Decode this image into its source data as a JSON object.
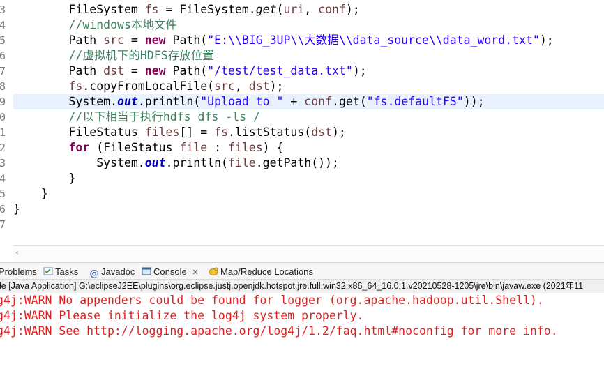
{
  "editor": {
    "line_numbers": [
      "3",
      "4",
      "5",
      "6",
      "7",
      "8",
      "9",
      "0",
      "1",
      "2",
      "3",
      "4",
      "5",
      "6",
      "7"
    ],
    "lines": [
      [
        {
          "t": "        FileSystem ",
          "c": ""
        },
        {
          "t": "fs",
          "c": "var"
        },
        {
          "t": " = FileSystem.",
          "c": ""
        },
        {
          "t": "get",
          "c": "mth"
        },
        {
          "t": "(",
          "c": ""
        },
        {
          "t": "uri",
          "c": "var"
        },
        {
          "t": ", ",
          "c": ""
        },
        {
          "t": "conf",
          "c": "var"
        },
        {
          "t": ");",
          "c": ""
        }
      ],
      [
        {
          "t": "        //windows本地文件",
          "c": "cm"
        }
      ],
      [
        {
          "t": "        Path ",
          "c": ""
        },
        {
          "t": "src",
          "c": "var"
        },
        {
          "t": " = ",
          "c": ""
        },
        {
          "t": "new",
          "c": "kw"
        },
        {
          "t": " Path(",
          "c": ""
        },
        {
          "t": "\"E:\\\\BIG_3UP\\\\大数据\\\\data_source\\\\data_word.txt\"",
          "c": "str"
        },
        {
          "t": ");",
          "c": ""
        }
      ],
      [
        {
          "t": "        //虚拟机下的HDFS存放位置",
          "c": "cm"
        }
      ],
      [
        {
          "t": "        Path ",
          "c": ""
        },
        {
          "t": "dst",
          "c": "var"
        },
        {
          "t": " = ",
          "c": ""
        },
        {
          "t": "new",
          "c": "kw"
        },
        {
          "t": " Path(",
          "c": ""
        },
        {
          "t": "\"/test/test_data.txt\"",
          "c": "str"
        },
        {
          "t": ");",
          "c": ""
        }
      ],
      [
        {
          "t": "        ",
          "c": ""
        },
        {
          "t": "fs",
          "c": "var"
        },
        {
          "t": ".copyFromLocalFile(",
          "c": ""
        },
        {
          "t": "src",
          "c": "var"
        },
        {
          "t": ", ",
          "c": ""
        },
        {
          "t": "dst",
          "c": "var"
        },
        {
          "t": ");",
          "c": ""
        }
      ],
      [
        {
          "t": "        System.",
          "c": ""
        },
        {
          "t": "out",
          "c": "fld"
        },
        {
          "t": ".println(",
          "c": ""
        },
        {
          "t": "\"Upload to \"",
          "c": "str"
        },
        {
          "t": " + ",
          "c": ""
        },
        {
          "t": "conf",
          "c": "var"
        },
        {
          "t": ".get(",
          "c": ""
        },
        {
          "t": "\"fs.defaultFS\"",
          "c": "str"
        },
        {
          "t": "));",
          "c": ""
        }
      ],
      [
        {
          "t": "        //以下相当于执行hdfs dfs -ls /",
          "c": "cm"
        }
      ],
      [
        {
          "t": "        FileStatus ",
          "c": ""
        },
        {
          "t": "files",
          "c": "var"
        },
        {
          "t": "[] = ",
          "c": ""
        },
        {
          "t": "fs",
          "c": "var"
        },
        {
          "t": ".listStatus(",
          "c": ""
        },
        {
          "t": "dst",
          "c": "var"
        },
        {
          "t": ");",
          "c": ""
        }
      ],
      [
        {
          "t": "        ",
          "c": ""
        },
        {
          "t": "for",
          "c": "kw"
        },
        {
          "t": " (FileStatus ",
          "c": ""
        },
        {
          "t": "file",
          "c": "var"
        },
        {
          "t": " : ",
          "c": ""
        },
        {
          "t": "files",
          "c": "var"
        },
        {
          "t": ") {",
          "c": ""
        }
      ],
      [
        {
          "t": "            System.",
          "c": ""
        },
        {
          "t": "out",
          "c": "fld"
        },
        {
          "t": ".println(",
          "c": ""
        },
        {
          "t": "file",
          "c": "var"
        },
        {
          "t": ".getPath());",
          "c": ""
        }
      ],
      [
        {
          "t": "        }",
          "c": ""
        }
      ],
      [
        {
          "t": "    }",
          "c": ""
        }
      ],
      [
        {
          "t": "}",
          "c": ""
        }
      ],
      [
        {
          "t": "",
          "c": ""
        }
      ]
    ],
    "current_line_index": 6
  },
  "tabs": [
    {
      "label": "Problems",
      "icon": "problems-icon"
    },
    {
      "label": "Tasks",
      "icon": "tasks-icon"
    },
    {
      "label": "Javadoc",
      "icon": "javadoc-icon"
    },
    {
      "label": "Console",
      "icon": "console-icon",
      "close": "✕"
    },
    {
      "label": "Map/Reduce Locations",
      "icon": "mapreduce-icon"
    }
  ],
  "console": {
    "header": "le [Java Application] G:\\eclipseJ2EE\\plugins\\org.eclipse.justj.openjdk.hotspot.jre.full.win32.x86_64_16.0.1.v20210528-1205\\jre\\bin\\javaw.exe  (2021年11",
    "lines": [
      "g4j:WARN No appenders could be found for logger (org.apache.hadoop.util.Shell).",
      "g4j:WARN Please initialize the log4j system properly.",
      "g4j:WARN See http://logging.apache.org/log4j/1.2/faq.html#noconfig for more info."
    ]
  },
  "colors": {
    "error": "#e02020",
    "keyword": "#7f0055",
    "string": "#2a00ff",
    "comment": "#3f7f5f"
  }
}
